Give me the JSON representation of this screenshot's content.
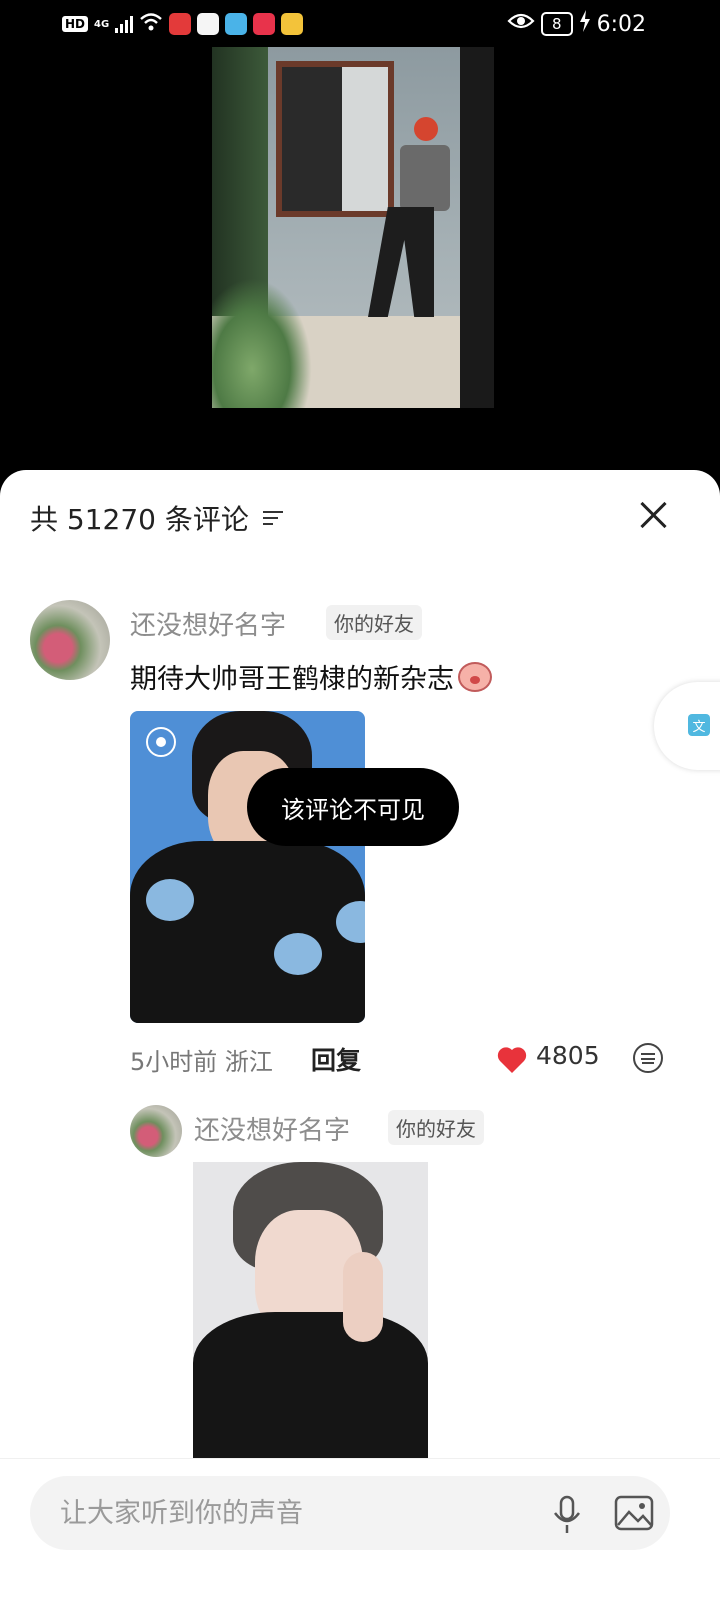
{
  "status_bar": {
    "network": "4G",
    "battery": "8",
    "time": "6:02",
    "hd_label": "HD"
  },
  "sheet": {
    "title": "共 51270 条评论"
  },
  "comment": {
    "username": "还没想好名字",
    "friend_tag": "你的好友",
    "text": "期待大帅哥王鹤棣的新杂志",
    "hidden_notice": "该评论不可见",
    "meta": "5小时前 浙江",
    "reply_label": "回复",
    "likes": "4805"
  },
  "reply": {
    "username": "还没想好名字",
    "friend_tag": "你的好友"
  },
  "input": {
    "placeholder": "让大家听到你的声音"
  },
  "colors": {
    "heart": "#e8333b",
    "sheet_bg": "#ffffff",
    "tag_bg": "#f1f1f1"
  },
  "icons": [
    "sort-icon",
    "close-icon",
    "heart-icon",
    "smile-icon",
    "mic-icon",
    "image-icon",
    "translate-icon"
  ]
}
